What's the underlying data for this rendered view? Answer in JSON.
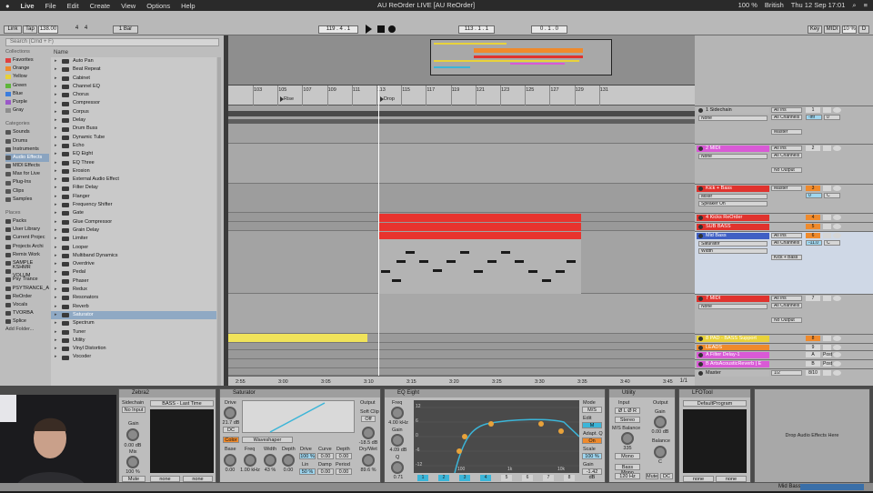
{
  "menubar": {
    "app": "Live",
    "items": [
      "File",
      "Edit",
      "Create",
      "View",
      "Options",
      "Help"
    ],
    "window_title": "AU ReOrder LIVE  [AU ReOrder]",
    "battery": "100 %",
    "lang": "British",
    "date": "Thu 12 Sep  17:01"
  },
  "transport": {
    "link": "Link",
    "tap": "Tap",
    "tempo": "138.00",
    "sig_num": "4",
    "sig_den": "4",
    "quant": "1 Bar",
    "pos": "119 . 4 . 1",
    "loop_start": "113 . 1 . 1",
    "loop_len": "0 . 1 . 0",
    "key": "Key",
    "midi": "MIDI",
    "cpu": "10 %",
    "d": "D"
  },
  "browser": {
    "search_placeholder": "Search (Cmd + F)",
    "collections_label": "Collections",
    "collections": [
      {
        "name": "Favorites",
        "color": "#e04040"
      },
      {
        "name": "Orange",
        "color": "#ef8a2c"
      },
      {
        "name": "Yellow",
        "color": "#e8d23a"
      },
      {
        "name": "Green",
        "color": "#5fb53b"
      },
      {
        "name": "Blue",
        "color": "#3b7ddd"
      },
      {
        "name": "Purple",
        "color": "#9a58c8"
      },
      {
        "name": "Gray",
        "color": "#8d8d8d"
      }
    ],
    "categories_label": "Categories",
    "categories": [
      "Sounds",
      "Drums",
      "Instruments",
      "Audio Effects",
      "MIDI Effects",
      "Max for Live",
      "Plug-Ins",
      "Clips",
      "Samples"
    ],
    "selected_category": "Audio Effects",
    "places_label": "Places",
    "places": [
      "Packs",
      "User Library",
      "Current Projec",
      "Projects Archi",
      "Remix Work",
      "SAMPLE",
      "KSHMR VOLUM",
      "Psy Trance",
      "PSYTRANCE_A",
      "ReOrder",
      "Vocals",
      "TVORBA",
      "Splice"
    ],
    "add_folder": "Add Folder...",
    "list_header": "Name",
    "items": [
      "Auto Pan",
      "Beat Repeat",
      "Cabinet",
      "Channel EQ",
      "Chorus",
      "Compressor",
      "Corpus",
      "Delay",
      "Drum Buss",
      "Dynamic Tube",
      "Echo",
      "EQ Eight",
      "EQ Three",
      "Erosion",
      "External Audio Effect",
      "Filter Delay",
      "Flanger",
      "Frequency Shifter",
      "Gate",
      "Glue Compressor",
      "Grain Delay",
      "Limiter",
      "Looper",
      "Multiband Dynamics",
      "Overdrive",
      "Pedal",
      "Phaser",
      "Redux",
      "Resonators",
      "Reverb",
      "Saturator",
      "Spectrum",
      "Tuner",
      "Utility",
      "Vinyl Distortion",
      "Vocoder"
    ],
    "selected_item": "Saturator"
  },
  "arrangement": {
    "bars": [
      "103",
      "105",
      "107",
      "109",
      "111",
      "113",
      "115",
      "117",
      "119",
      "121",
      "123",
      "125",
      "127",
      "129",
      "131"
    ],
    "locators": [
      {
        "name": "Rise"
      },
      {
        "name": "Drop"
      }
    ],
    "times": [
      "2:55",
      "3:00",
      "3:05",
      "3:10",
      "3:15",
      "3:20",
      "3:25",
      "3:30",
      "3:35",
      "3:40",
      "3:45"
    ],
    "fraction": "1/1"
  },
  "tracks": [
    {
      "name": "1 Sidechain",
      "color": "#b9b9b9",
      "input": "All Ins",
      "sub": "None",
      "ch": "All Channels",
      "out": "Master",
      "num": "1",
      "vol": "-inf",
      "pan": "0"
    },
    {
      "name": "2 MIDI",
      "color": "#d95ad6",
      "input": "All Ins",
      "sub": "None",
      "ch": "All Channels",
      "out": "No Output",
      "num": "2"
    },
    {
      "name": "Kick + Bass",
      "color": "#e0332e",
      "input": "Master",
      "sub": "Mixer",
      "sub2": "Speaker On",
      "num": "3",
      "vol": "0",
      "pan": "C"
    },
    {
      "name": "4 Kicks ReOrder",
      "color": "#e0332e",
      "num": "4"
    },
    {
      "name": "SUB BASS",
      "color": "#e0332e",
      "num": "5"
    },
    {
      "name": "Mid Bass",
      "color": "#3f5fc4",
      "input": "All Ins",
      "sub": "Saturator",
      "sub2": "Width",
      "ch": "All Channels",
      "out": "Kick + Bass",
      "num": "6",
      "vol": "-11.0",
      "pan": "C"
    },
    {
      "name": "7 MIDI",
      "color": "#e0332e",
      "input": "All Ins",
      "sub": "None",
      "ch": "All Channels",
      "out": "No Output",
      "num": "7"
    },
    {
      "name": "8 PAD - BASS Support",
      "color": "#e8d23a",
      "num": "8"
    },
    {
      "name": "LEADS",
      "color": "#ef8a2c",
      "num": "9"
    },
    {
      "name": "A Filter Delay-1",
      "color": "#d95ad6",
      "num": "A",
      "post": "Post"
    },
    {
      "name": "B ArtsAcousticReverb | E",
      "color": "#d95ad6",
      "num": "B",
      "post": "Post"
    },
    {
      "name": "Master",
      "color": "#b9b9b9",
      "out": "1/2",
      "num": "8/10"
    }
  ],
  "devices": {
    "zebra": {
      "title": "Zebra2",
      "sidechain": "Sidechain",
      "input": "No Input",
      "gain_label": "Gain",
      "gain": "0.00 dB",
      "mix_label": "Mix",
      "mix": "100 %",
      "mute": "Mute",
      "preset": "BASS - Last Time",
      "none1": "none",
      "none2": "none"
    },
    "saturator": {
      "title": "Saturator",
      "drive_label": "Drive",
      "drive": "21.7 dB",
      "dc": "DC",
      "color_label": "Color",
      "mode": "Waveshaper",
      "output_label": "Output",
      "soft_clip": "Soft Clip",
      "off": "Off",
      "out_val": "-18.5 dB",
      "drywet_label": "Dry/Wet",
      "drywet": "89.6 %",
      "base_label": "Base",
      "base": "0.00",
      "freq_label": "Freq",
      "freq": "1.00 kHz",
      "width_label": "Width",
      "width": "43 %",
      "depth_label": "Depth",
      "depth": "0.00",
      "p_drive": "Drive",
      "p_drive_v": "100 %",
      "p_curve": "Curve",
      "p_curve_v": "0.00",
      "p_depth": "Depth",
      "p_depth_v": "0.00",
      "p_lin": "Lin",
      "p_lin_v": "50 %",
      "p_damp": "Damp",
      "p_damp_v": "0.00",
      "p_period": "Period",
      "p_period_v": "0.00"
    },
    "eq": {
      "title": "EQ Eight",
      "freq_label": "Freq",
      "freq": "4.00 kHz",
      "gain_label": "Gain",
      "gain": "4.09 dB",
      "q_label": "Q",
      "q": "0.71",
      "mode_label": "Mode",
      "mode": "M/S",
      "edit_label": "Edit",
      "edit": "M",
      "adapt_label": "Adapt. Q",
      "adapt": "On",
      "scale_label": "Scale",
      "scale": "100 %",
      "gain2_label": "Gain",
      "gain2": "-1.42 dB",
      "db_ticks": [
        "12",
        "6",
        "0",
        "-6",
        "-12"
      ],
      "freq_ticks": [
        "100",
        "1k",
        "10k"
      ],
      "bands": [
        "1",
        "2",
        "3",
        "4",
        "5",
        "6",
        "7",
        "8"
      ]
    },
    "utility": {
      "title": "Utility",
      "input": "Input",
      "output": "Output",
      "gain_label": "Gain",
      "gain": "0.00 dB",
      "stereo": "Stereo",
      "ms_label": "M/S Balance",
      "ms": "335",
      "mono": "Mono",
      "bass_mono": "Bass Mono",
      "bass_freq": "120 Hz",
      "balance_label": "Balance",
      "balance": "C",
      "mute": "Mute",
      "dc": "DC"
    },
    "lfotool": {
      "title": "LFOTool",
      "preset": "DefaultProgram",
      "none1": "none",
      "none2": "none"
    },
    "drop": "Drop Audio Effects Here"
  },
  "statusbar": {
    "track": "Mid Bass"
  }
}
